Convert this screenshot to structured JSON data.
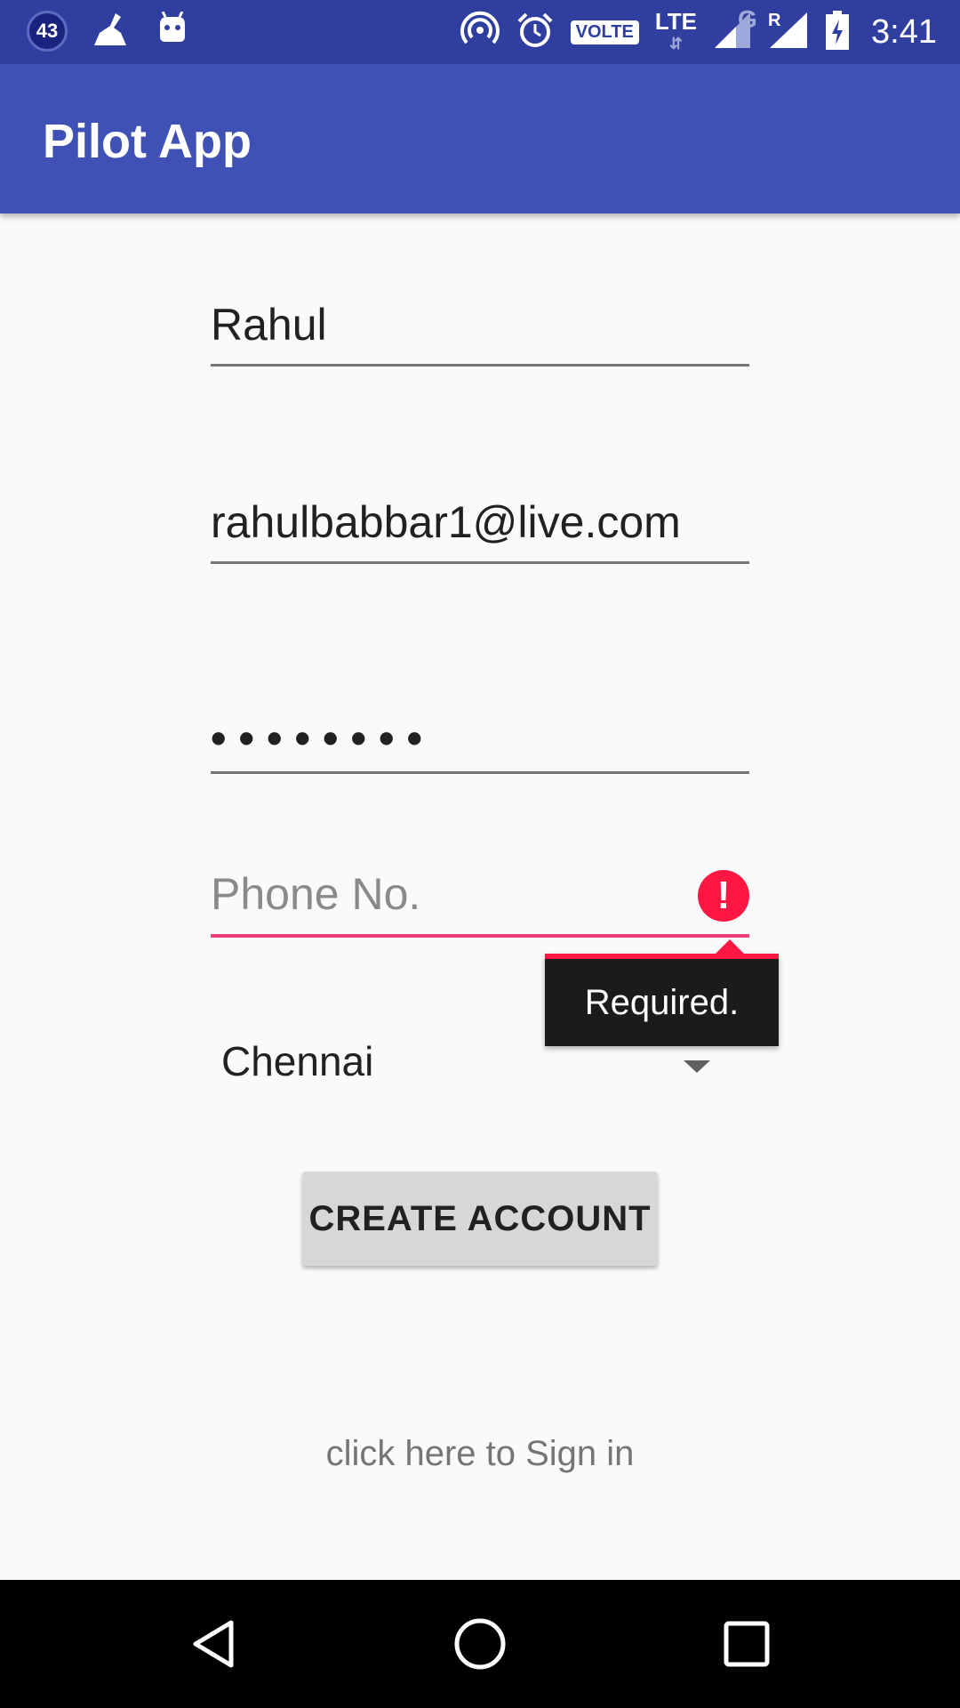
{
  "status_bar": {
    "notification_count": "43",
    "time": "3:41",
    "volte": "VOLTE",
    "lte": "LTE",
    "network_g": "G",
    "roaming": "R",
    "icons": [
      "notification-badge",
      "broom-icon",
      "android-icon",
      "hotspot-icon",
      "alarm-icon",
      "volte-icon",
      "lte-icon",
      "signal-icon",
      "signal-roaming-icon",
      "battery-charging-icon"
    ]
  },
  "app_bar": {
    "title": "Pilot App"
  },
  "form": {
    "name_value": "Rahul",
    "email_value": "rahulbabbar1@live.com",
    "password_masked": "••••••••",
    "phone_placeholder": "Phone No.",
    "phone_error": "Required.",
    "city_selected": "Chennai",
    "create_button_label": "CREATE ACCOUNT",
    "sign_in_link": "click here to Sign in"
  },
  "colors": {
    "status_bar": "#303f9f",
    "app_bar": "#3f51b5",
    "error": "#ff1744",
    "accent_underline": "#ec407a"
  },
  "nav_bar": {
    "icons": [
      "back-icon",
      "home-icon",
      "recents-icon"
    ]
  }
}
